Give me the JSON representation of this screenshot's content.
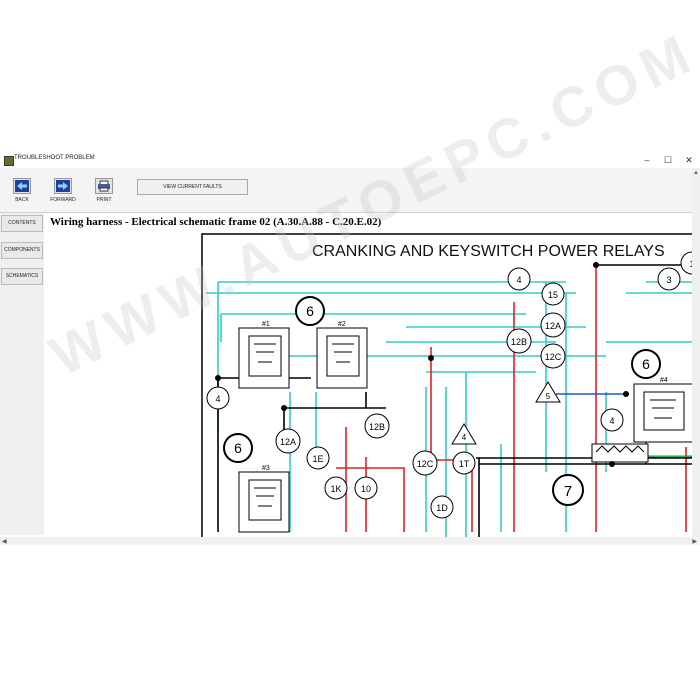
{
  "window": {
    "title": "TROUBLESHOOT PROBLEM",
    "controls": {
      "minimize": "–",
      "maximize": "☐",
      "close": "✕"
    }
  },
  "toolbar": {
    "back_label": "BACK",
    "forward_label": "FORWARD",
    "print_label": "PRINT",
    "faults_label": "VIEW CURRENT FAULTS"
  },
  "sidebar": {
    "items": [
      {
        "label": "CONTENTS"
      },
      {
        "label": "COMPONENTS"
      },
      {
        "label": "SCHEMATICS"
      }
    ]
  },
  "document": {
    "heading": "Wiring harness - Electrical schematic frame 02 (A.30.A.88 - C.20.E.02)"
  },
  "schematic": {
    "title": "CRANKING AND KEYSWITCH POWER RELAYS",
    "relay_labels": [
      "#1",
      "#2",
      "#3",
      "#4"
    ],
    "circles": [
      "6",
      "6",
      "6",
      "6",
      "4",
      "4",
      "4",
      "15",
      "12A",
      "12B",
      "12C",
      "12A",
      "12B",
      "12C",
      "1E",
      "1K",
      "10",
      "1T",
      "1D",
      "3",
      "7",
      "1"
    ],
    "triangles": [
      "5",
      "4"
    ]
  },
  "watermark": "WWW.AUTOEPC.COM",
  "colors": {
    "cyan_wire": "#33cccc",
    "red_wire": "#dd2222",
    "blue_wire": "#2255cc",
    "green_wire": "#22aa22"
  }
}
